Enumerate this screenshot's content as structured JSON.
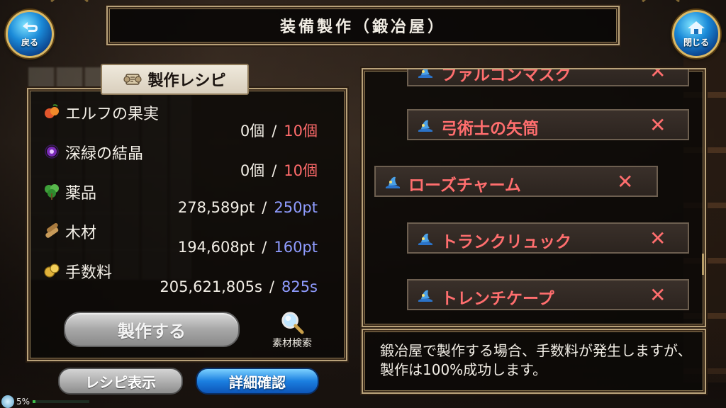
{
  "header": {
    "title": "装備製作（鍛冶屋）"
  },
  "nav": {
    "back_label": "戻る",
    "close_label": "閉じる"
  },
  "recipe": {
    "tab_label": "製作レシピ",
    "materials": [
      {
        "name": "エルフの果実",
        "have": "0個",
        "need": "10個",
        "need_color": "red",
        "icon": "fruit-icon"
      },
      {
        "name": "深緑の結晶",
        "have": "0個",
        "need": "10個",
        "need_color": "red",
        "icon": "crystal-icon"
      },
      {
        "name": "薬品",
        "have": "278,589pt",
        "need": "250pt",
        "need_color": "blue",
        "icon": "herb-icon"
      },
      {
        "name": "木材",
        "have": "194,608pt",
        "need": "160pt",
        "need_color": "blue",
        "icon": "wood-icon"
      },
      {
        "name": "手数料",
        "have": "205,621,805s",
        "need": "825s",
        "need_color": "blue",
        "icon": "coin-icon"
      }
    ],
    "separator": "/",
    "craft_button": "製作する",
    "search_label": "素材検索"
  },
  "bottom": {
    "recipe_view": "レシピ表示",
    "detail_confirm": "詳細確認",
    "progress_pct": "5%",
    "progress_fraction": 0.05
  },
  "equipment_list": [
    {
      "name": "ファルコンマスク",
      "mark": "✕"
    },
    {
      "name": "弓術士の矢筒",
      "mark": "✕"
    },
    {
      "name": "ローズチャーム",
      "mark": "✕"
    },
    {
      "name": "トランクリュック",
      "mark": "✕"
    },
    {
      "name": "トレンチケープ",
      "mark": "✕"
    }
  ],
  "message": "鍛冶屋で製作する場合、手数料が発生しますが、製作は100%成功します。",
  "colors": {
    "need_red": "#ff6b6b",
    "need_blue": "#8f9cff",
    "item_text": "#ff6e6e",
    "frame_gold": "#b9a27a"
  }
}
